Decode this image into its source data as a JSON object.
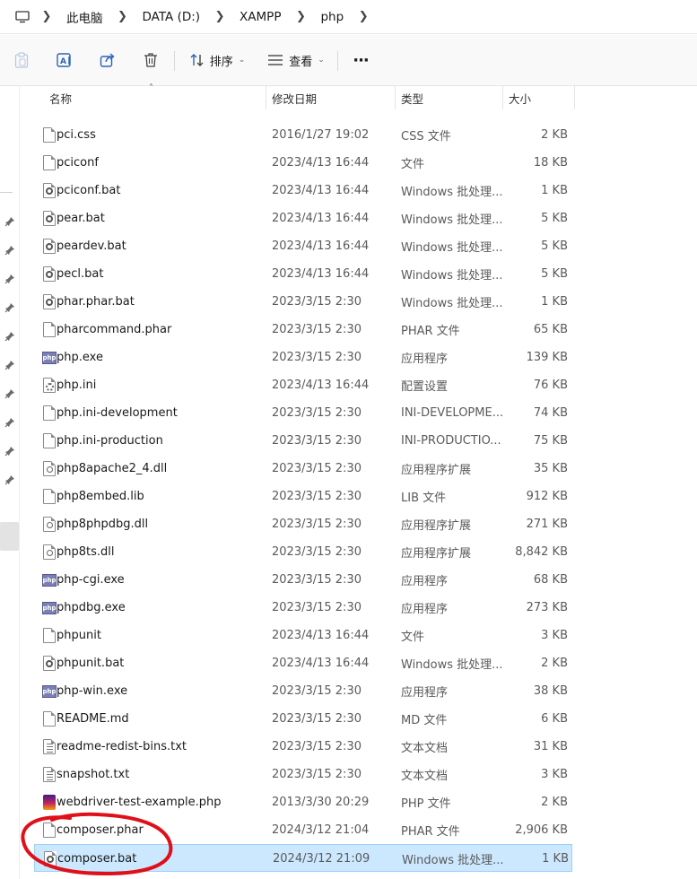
{
  "breadcrumb": [
    "此电脑",
    "DATA (D:)",
    "XAMPP",
    "php"
  ],
  "toolbar": {
    "sort_label": "排序",
    "view_label": "查看",
    "more_label": "···"
  },
  "columns": {
    "name": "名称",
    "date": "修改日期",
    "type": "类型",
    "size": "大小"
  },
  "files": [
    {
      "name": "pci.css",
      "date": "2016/1/27 19:02",
      "type": "CSS 文件",
      "size": "2 KB",
      "icon": "doc"
    },
    {
      "name": "pciconf",
      "date": "2023/4/13 16:44",
      "type": "文件",
      "size": "18 KB",
      "icon": "doc"
    },
    {
      "name": "pciconf.bat",
      "date": "2023/4/13 16:44",
      "type": "Windows 批处理...",
      "size": "1 KB",
      "icon": "bat"
    },
    {
      "name": "pear.bat",
      "date": "2023/4/13 16:44",
      "type": "Windows 批处理...",
      "size": "5 KB",
      "icon": "bat"
    },
    {
      "name": "peardev.bat",
      "date": "2023/4/13 16:44",
      "type": "Windows 批处理...",
      "size": "5 KB",
      "icon": "bat"
    },
    {
      "name": "pecl.bat",
      "date": "2023/4/13 16:44",
      "type": "Windows 批处理...",
      "size": "5 KB",
      "icon": "bat"
    },
    {
      "name": "phar.phar.bat",
      "date": "2023/3/15 2:30",
      "type": "Windows 批处理...",
      "size": "1 KB",
      "icon": "bat"
    },
    {
      "name": "pharcommand.phar",
      "date": "2023/3/15 2:30",
      "type": "PHAR 文件",
      "size": "65 KB",
      "icon": "doc"
    },
    {
      "name": "php.exe",
      "date": "2023/3/15 2:30",
      "type": "应用程序",
      "size": "139 KB",
      "icon": "exe"
    },
    {
      "name": "php.ini",
      "date": "2023/4/13 16:44",
      "type": "配置设置",
      "size": "76 KB",
      "icon": "ini"
    },
    {
      "name": "php.ini-development",
      "date": "2023/3/15 2:30",
      "type": "INI-DEVELOPME...",
      "size": "74 KB",
      "icon": "doc"
    },
    {
      "name": "php.ini-production",
      "date": "2023/3/15 2:30",
      "type": "INI-PRODUCTIO...",
      "size": "75 KB",
      "icon": "doc"
    },
    {
      "name": "php8apache2_4.dll",
      "date": "2023/3/15 2:30",
      "type": "应用程序扩展",
      "size": "35 KB",
      "icon": "dll"
    },
    {
      "name": "php8embed.lib",
      "date": "2023/3/15 2:30",
      "type": "LIB 文件",
      "size": "912 KB",
      "icon": "doc"
    },
    {
      "name": "php8phpdbg.dll",
      "date": "2023/3/15 2:30",
      "type": "应用程序扩展",
      "size": "271 KB",
      "icon": "dll"
    },
    {
      "name": "php8ts.dll",
      "date": "2023/3/15 2:30",
      "type": "应用程序扩展",
      "size": "8,842 KB",
      "icon": "dll"
    },
    {
      "name": "php-cgi.exe",
      "date": "2023/3/15 2:30",
      "type": "应用程序",
      "size": "68 KB",
      "icon": "exe"
    },
    {
      "name": "phpdbg.exe",
      "date": "2023/3/15 2:30",
      "type": "应用程序",
      "size": "273 KB",
      "icon": "exe"
    },
    {
      "name": "phpunit",
      "date": "2023/4/13 16:44",
      "type": "文件",
      "size": "3 KB",
      "icon": "doc"
    },
    {
      "name": "phpunit.bat",
      "date": "2023/4/13 16:44",
      "type": "Windows 批处理...",
      "size": "2 KB",
      "icon": "bat"
    },
    {
      "name": "php-win.exe",
      "date": "2023/3/15 2:30",
      "type": "应用程序",
      "size": "38 KB",
      "icon": "exe"
    },
    {
      "name": "README.md",
      "date": "2023/3/15 2:30",
      "type": "MD 文件",
      "size": "6 KB",
      "icon": "doc"
    },
    {
      "name": "readme-redist-bins.txt",
      "date": "2023/3/15 2:30",
      "type": "文本文档",
      "size": "31 KB",
      "icon": "txt"
    },
    {
      "name": "snapshot.txt",
      "date": "2023/3/15 2:30",
      "type": "文本文档",
      "size": "3 KB",
      "icon": "txt"
    },
    {
      "name": "webdriver-test-example.php",
      "date": "2013/3/30 20:29",
      "type": "PHP 文件",
      "size": "2 KB",
      "icon": "php"
    },
    {
      "name": "composer.phar",
      "date": "2024/3/12 21:04",
      "type": "PHAR 文件",
      "size": "2,906 KB",
      "icon": "doc"
    },
    {
      "name": "composer.bat",
      "date": "2024/3/12 21:09",
      "type": "Windows 批处理...",
      "size": "1 KB",
      "icon": "bat",
      "selected": true
    }
  ],
  "colors": {
    "selection_bg": "#cce8ff",
    "selection_border": "#99d1ff",
    "annotation": "#e0101a"
  }
}
